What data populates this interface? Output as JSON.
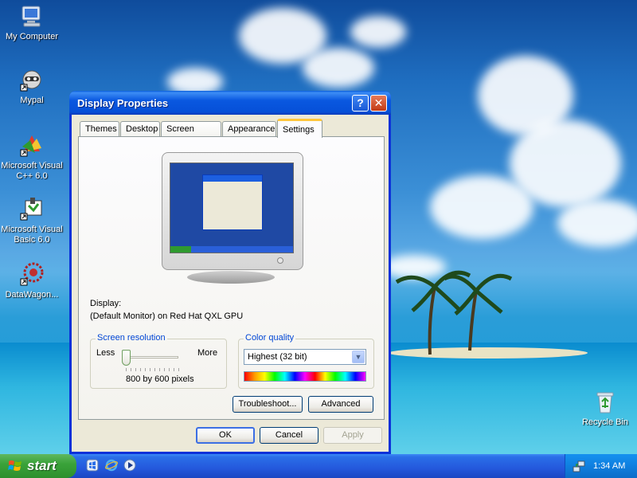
{
  "desktop": {
    "icons": [
      {
        "label": "My Computer",
        "icon": "computer-icon"
      },
      {
        "label": "Mypal",
        "icon": "raccoon-icon"
      },
      {
        "label": "Microsoft Visual C++ 6.0",
        "icon": "visual-cpp-icon"
      },
      {
        "label": "Microsoft Visual Basic 6.0",
        "icon": "visual-basic-icon"
      },
      {
        "label": "DataWagon...",
        "icon": "datawagon-icon"
      },
      {
        "label": "Recycle Bin",
        "icon": "recycle-bin-icon"
      }
    ]
  },
  "dialog": {
    "title": "Display Properties",
    "help_button": "?",
    "close_button": "✕",
    "tabs": [
      "Themes",
      "Desktop",
      "Screen Saver",
      "Appearance",
      "Settings"
    ],
    "active_tab": "Settings",
    "display_label": "Display:",
    "display_value": "(Default Monitor) on Red Hat QXL GPU",
    "resolution": {
      "legend": "Screen resolution",
      "less_label": "Less",
      "more_label": "More",
      "value_text": "800 by 600 pixels",
      "slider_position": 0.0
    },
    "color_quality": {
      "legend": "Color quality",
      "selected": "Highest (32 bit)",
      "arrow": "▼"
    },
    "buttons": {
      "troubleshoot": "Troubleshoot...",
      "advanced": "Advanced",
      "ok": "OK",
      "cancel": "Cancel",
      "apply": "Apply"
    }
  },
  "taskbar": {
    "start_label": "start",
    "quick_launch": [
      "windows-media-icon",
      "internet-explorer-icon",
      "media-player-icon"
    ],
    "clock": "1:34 AM"
  },
  "colors": {
    "title_bar": "#0a58e0",
    "dialog_bg": "#ece9d8",
    "group_legend": "#0046d5",
    "taskbar": "#2458dc",
    "start_button": "#3aa33a"
  }
}
